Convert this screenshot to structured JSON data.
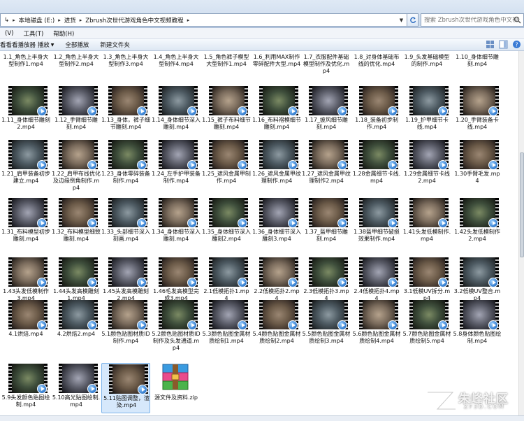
{
  "address": {
    "crumbs": [
      "本地磁盘 (E:)",
      "进货",
      "Zbrush次世代游戏角色中文视频教程"
    ],
    "search_placeholder": "搜索 Zbrush次世代游戏角色中文视..."
  },
  "menu": [
    "(V)",
    "工具(T)",
    "帮助(H)"
  ],
  "toolbar": {
    "play": "看看看播放器 播放",
    "play_all": "全部播放",
    "new_folder": "新建文件夹"
  },
  "rows": [
    [
      "1.1_角色上半身大型制作1.mp4",
      "1.2_角色上半身大型制作2.mp4",
      "1.3_角色上半身大型制作3.mp4",
      "1.4_角色上半身大型制作4.mp4",
      "1.5_角色裤子模型大型制作1.mp4",
      "1.6_利用MAX制作零碎配件大型.mp4",
      "1.7_衣服配件基础模型制作及优化.mp4",
      "1.8_对身体基础布线的优化.mp4",
      "1.9_头发基础模型的制作.mp4",
      "1.10_身体细节雕刻.mp4"
    ],
    [
      "1.11_身体细节雕刻2.mp4",
      "1.12_手臂细节雕刻.mp4",
      "1.13_身体，裤子细节雕刻.mp4",
      "1.14_身体细节深入雕刻.mp4",
      "1.15_裤子布料细节雕刻.mp4",
      "1.16_布料褶模细节雕刻.mp4",
      "1.17_披风细节雕刻.mp4",
      "1.18_装备初步制作.mp4",
      "1.19_护甲细节卡线.mp4",
      "1.20_手臂装备卡线.mp4"
    ],
    [
      "1.21_肩甲装备初步建立.mp4",
      "1.22_肩甲布线优化及边缘倒角制作.mp4",
      "1.23_身体零碎装备制作.mp4",
      "1.24_左手护甲装备制作.mp4",
      "1.25_遮风金属甲制作.mp4",
      "1.26_遮风金属甲纹理制作.mp4",
      "1.27_遮风金属甲纹理制作2.mp4",
      "1.28金属细节卡线.mp4",
      "1.29金属细节卡线2.mp4",
      "1.30手臂毛发.mp4"
    ],
    [
      "1.31_布料模型初步雕刻.mp4",
      "1.32_布料模型细致雕刻.mp4",
      "1.33_头部细节深入刻画.mp4",
      "1.34_身体细节深入雕刻.mp4",
      "1.35_身体细节深入雕刻2.mp4",
      "1.36_身体细节深入雕刻3.mp4",
      "1.37_盔甲细节雕刻.mp4",
      "1.38盔甲细节破损效果制作.mp4",
      "1.41头发低模制作.mp4",
      "1.42头发低模制作2.mp4"
    ],
    [
      "1.43头发低模制作3.mp4",
      "1.44头发高模雕刻1.mp4",
      "1.45头发高模雕刻2.mp4",
      "1.46毛发高模型完成3.mp4",
      "2.1低模拓扑1.mp4",
      "2.2低模拓扑2.mp4",
      "2.3低模拓扑3.mp4",
      "2.4低模拓扑4.mp4",
      "3.1低模UV拆分.mp4",
      "3.2低模UV整合.mp4"
    ],
    [
      "4.1烘焙.mp4",
      "4.2烘焙2.mp4",
      "5.1颜色贴图材质ID制作.mp4",
      "5.2颜色贴图材质ID制作及头发通道.mp4",
      "5.3颜色贴图金属材质绘制1.mp4",
      "5.4颜色贴图金属材质绘制2.mp4",
      "5.5颜色贴图金属材质绘制3.mp4",
      "5.6颜色贴图金属材质绘制4.mp4",
      "5.7颜色贴图金属材质绘制5.mp4",
      "5.8身体颜色贴图绘制.mp4"
    ],
    [
      "5.9头发颜色贴图绘制.mp4",
      "5.10高光贴图绘制.mp4",
      "5.11贴图调整，渲染.mp4",
      "源文件及资料.zip"
    ]
  ],
  "watermark": {
    "text": "朱峰社区",
    "sub": "ZF3D.COM"
  },
  "colors": {
    "selection": "#d6e8fb",
    "badge": "#2f79cc",
    "chrome": "#dfe9f5"
  }
}
